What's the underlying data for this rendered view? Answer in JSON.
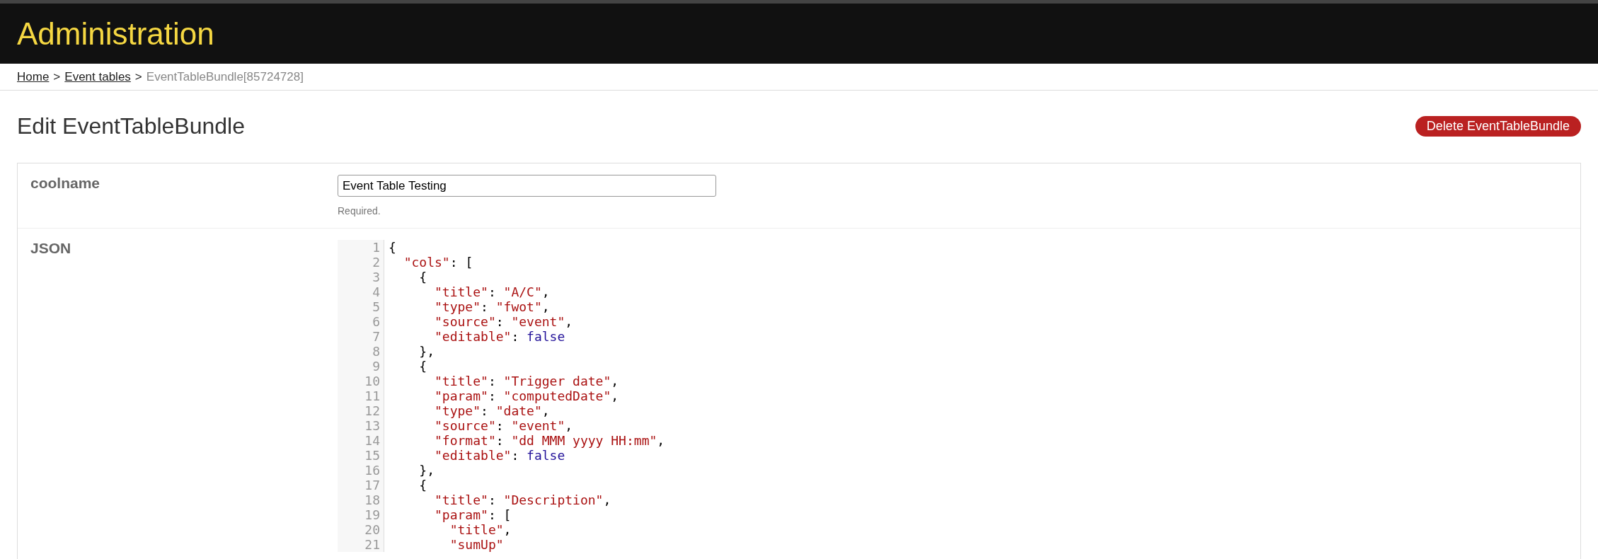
{
  "header": {
    "title": "Administration"
  },
  "breadcrumb": {
    "links": [
      "Home",
      "Event tables"
    ],
    "separator": ">",
    "current": "EventTableBundle[85724728]"
  },
  "page": {
    "heading": "Edit EventTableBundle",
    "delete_button": "Delete EventTableBundle"
  },
  "form": {
    "fields": [
      {
        "kind": "text",
        "label": "coolname",
        "value": "Event Table Testing",
        "help": "Required."
      },
      {
        "kind": "code",
        "label": "JSON",
        "lines": [
          {
            "number": "1",
            "tokens": [
              {
                "kind": "plain",
                "text": "{"
              }
            ]
          },
          {
            "number": "2",
            "tokens": [
              {
                "kind": "string",
                "text": "  \"cols\""
              },
              {
                "kind": "plain",
                "text": ": ["
              }
            ]
          },
          {
            "number": "3",
            "tokens": [
              {
                "kind": "plain",
                "text": "    {"
              }
            ]
          },
          {
            "number": "4",
            "tokens": [
              {
                "kind": "string",
                "text": "      \"title\""
              },
              {
                "kind": "plain",
                "text": ": "
              },
              {
                "kind": "string",
                "text": "\"A/C\""
              },
              {
                "kind": "plain",
                "text": ","
              }
            ]
          },
          {
            "number": "5",
            "tokens": [
              {
                "kind": "string",
                "text": "      \"type\""
              },
              {
                "kind": "plain",
                "text": ": "
              },
              {
                "kind": "string",
                "text": "\"fwot\""
              },
              {
                "kind": "plain",
                "text": ","
              }
            ]
          },
          {
            "number": "6",
            "tokens": [
              {
                "kind": "string",
                "text": "      \"source\""
              },
              {
                "kind": "plain",
                "text": ": "
              },
              {
                "kind": "string",
                "text": "\"event\""
              },
              {
                "kind": "plain",
                "text": ","
              }
            ]
          },
          {
            "number": "7",
            "tokens": [
              {
                "kind": "string",
                "text": "      \"editable\""
              },
              {
                "kind": "plain",
                "text": ": "
              },
              {
                "kind": "atom",
                "text": "false"
              }
            ]
          },
          {
            "number": "8",
            "tokens": [
              {
                "kind": "plain",
                "text": "    },"
              }
            ]
          },
          {
            "number": "9",
            "tokens": [
              {
                "kind": "plain",
                "text": "    {"
              }
            ]
          },
          {
            "number": "10",
            "tokens": [
              {
                "kind": "string",
                "text": "      \"title\""
              },
              {
                "kind": "plain",
                "text": ": "
              },
              {
                "kind": "string",
                "text": "\"Trigger date\""
              },
              {
                "kind": "plain",
                "text": ","
              }
            ]
          },
          {
            "number": "11",
            "tokens": [
              {
                "kind": "string",
                "text": "      \"param\""
              },
              {
                "kind": "plain",
                "text": ": "
              },
              {
                "kind": "string",
                "text": "\"computedDate\""
              },
              {
                "kind": "plain",
                "text": ","
              }
            ]
          },
          {
            "number": "12",
            "tokens": [
              {
                "kind": "string",
                "text": "      \"type\""
              },
              {
                "kind": "plain",
                "text": ": "
              },
              {
                "kind": "string",
                "text": "\"date\""
              },
              {
                "kind": "plain",
                "text": ","
              }
            ]
          },
          {
            "number": "13",
            "tokens": [
              {
                "kind": "string",
                "text": "      \"source\""
              },
              {
                "kind": "plain",
                "text": ": "
              },
              {
                "kind": "string",
                "text": "\"event\""
              },
              {
                "kind": "plain",
                "text": ","
              }
            ]
          },
          {
            "number": "14",
            "tokens": [
              {
                "kind": "string",
                "text": "      \"format\""
              },
              {
                "kind": "plain",
                "text": ": "
              },
              {
                "kind": "string",
                "text": "\"dd MMM yyyy HH:mm\""
              },
              {
                "kind": "plain",
                "text": ","
              }
            ]
          },
          {
            "number": "15",
            "tokens": [
              {
                "kind": "string",
                "text": "      \"editable\""
              },
              {
                "kind": "plain",
                "text": ": "
              },
              {
                "kind": "atom",
                "text": "false"
              }
            ]
          },
          {
            "number": "16",
            "tokens": [
              {
                "kind": "plain",
                "text": "    },"
              }
            ]
          },
          {
            "number": "17",
            "tokens": [
              {
                "kind": "plain",
                "text": "    {"
              }
            ]
          },
          {
            "number": "18",
            "tokens": [
              {
                "kind": "string",
                "text": "      \"title\""
              },
              {
                "kind": "plain",
                "text": ": "
              },
              {
                "kind": "string",
                "text": "\"Description\""
              },
              {
                "kind": "plain",
                "text": ","
              }
            ]
          },
          {
            "number": "19",
            "tokens": [
              {
                "kind": "string",
                "text": "      \"param\""
              },
              {
                "kind": "plain",
                "text": ": ["
              }
            ]
          },
          {
            "number": "20",
            "tokens": [
              {
                "kind": "string",
                "text": "        \"title\""
              },
              {
                "kind": "plain",
                "text": ","
              }
            ]
          },
          {
            "number": "21",
            "tokens": [
              {
                "kind": "string",
                "text": "        \"sumUp\""
              }
            ]
          }
        ]
      }
    ]
  }
}
